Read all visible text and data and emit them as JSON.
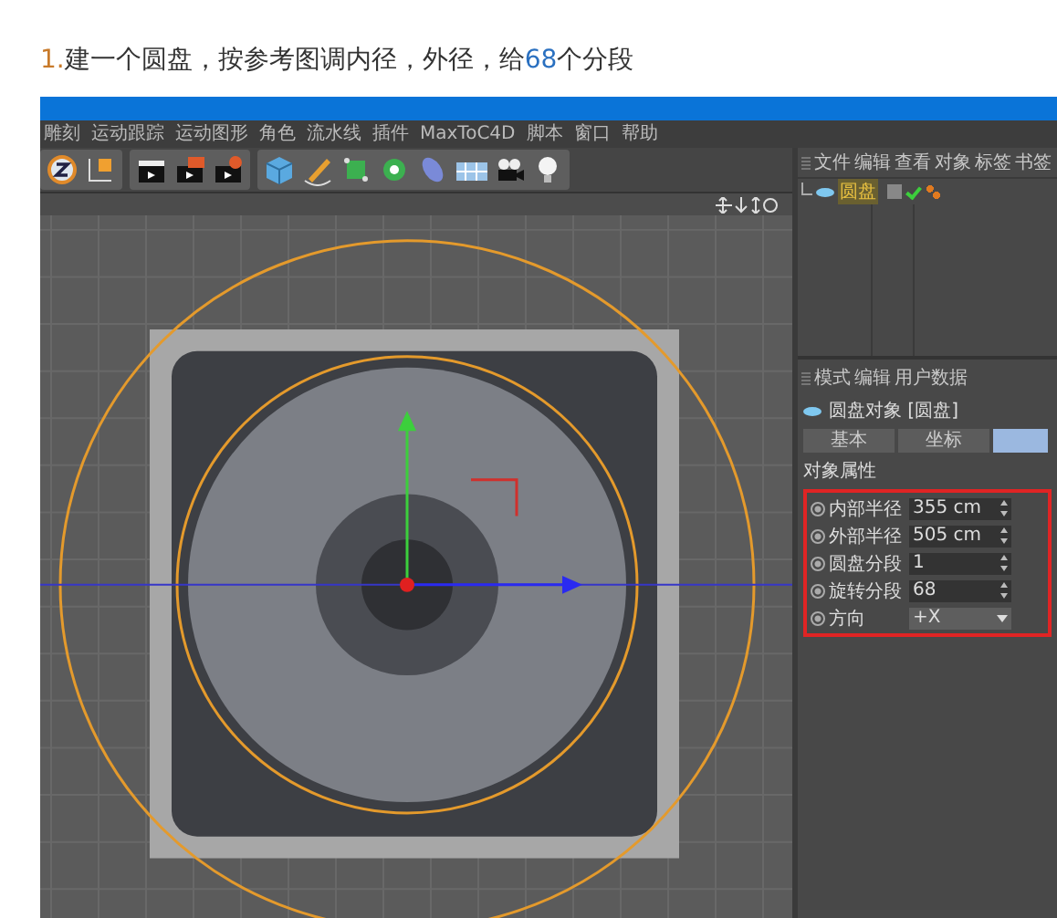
{
  "instruction": [
    {
      "kind": "number",
      "text": "1."
    },
    {
      "kind": "plain",
      "text": "建一个圆盘，按参考图调内径，外径，给"
    },
    {
      "kind": "number",
      "text": "68"
    },
    {
      "kind": "plain",
      "text": "个分段"
    }
  ],
  "app": {
    "menu": [
      "雕刻",
      "运动跟踪",
      "运动图形",
      "角色",
      "流水线",
      "插件",
      "MaxToC4D",
      "脚本",
      "窗口",
      "帮助"
    ],
    "object_manager": {
      "menu": [
        "文件",
        "编辑",
        "查看",
        "对象",
        "标签",
        "书签"
      ],
      "objects": [
        {
          "name": "圆盘"
        }
      ]
    },
    "attribute_manager": {
      "menu": [
        "模式",
        "编辑",
        "用户数据"
      ],
      "object_title": "圆盘对象 [圆盘]",
      "tabs": [
        {
          "label": "基本",
          "selected": false
        },
        {
          "label": "坐标",
          "selected": false
        },
        {
          "selected": true
        }
      ],
      "section_title": "对象属性",
      "highlighted": true,
      "fields": [
        {
          "kind": "number",
          "label": "内部半径",
          "value": "355 cm"
        },
        {
          "kind": "number",
          "label": "外部半径",
          "value": "505 cm"
        },
        {
          "kind": "number",
          "label": "圆盘分段",
          "value": "1"
        },
        {
          "kind": "number",
          "label": "旋转分段",
          "value": "68"
        },
        {
          "kind": "dropdown",
          "label": "方向",
          "value": "+X"
        }
      ]
    }
  }
}
